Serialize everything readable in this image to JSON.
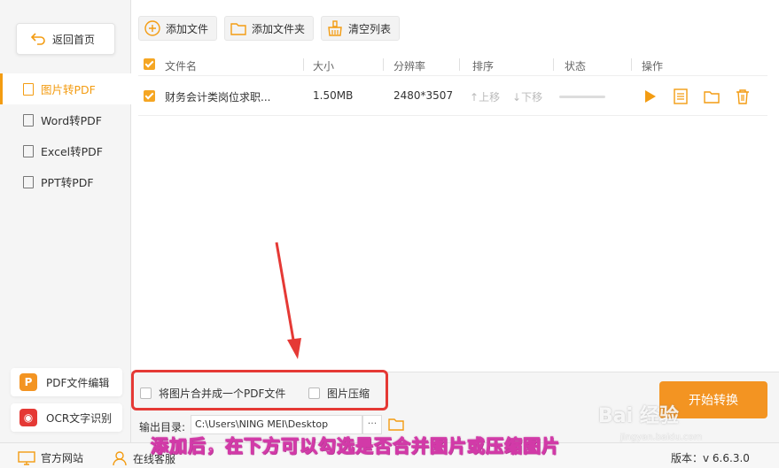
{
  "sidebar": {
    "back_label": "返回首页",
    "items": [
      {
        "label": "图片转PDF",
        "active": true
      },
      {
        "label": "Word转PDF",
        "active": false
      },
      {
        "label": "Excel转PDF",
        "active": false
      },
      {
        "label": "PPT转PDF",
        "active": false
      }
    ],
    "tools": [
      {
        "label": "PDF文件编辑"
      },
      {
        "label": "OCR文字识别"
      }
    ]
  },
  "toolbar": {
    "add_file": "添加文件",
    "add_folder": "添加文件夹",
    "clear_list": "清空列表"
  },
  "table": {
    "headers": {
      "filename": "文件名",
      "size": "大小",
      "resolution": "分辨率",
      "sort": "排序",
      "status": "状态",
      "action": "操作"
    },
    "rows": [
      {
        "filename": "财务会计类岗位求职...",
        "size": "1.50MB",
        "resolution": "2480*3507",
        "up": "上移",
        "down": "下移",
        "checked": true
      }
    ]
  },
  "options": {
    "merge_label": "将图片合并成一个PDF文件",
    "compress_label": "图片压缩"
  },
  "output": {
    "label": "输出目录:",
    "path": "C:\\Users\\NING MEI\\Desktop",
    "more": "···"
  },
  "start_button": "开始转换",
  "footer": {
    "website": "官方网站",
    "support": "在线客服",
    "version": "版本：v 6.6.3.0"
  },
  "caption": "添加后，在下方可以勾选是否合并图片或压缩图片",
  "watermark": {
    "brand": "Bai 经验",
    "url": "jingyan.baidu.com"
  },
  "colors": {
    "accent": "#f39c12",
    "highlight": "#e53935"
  }
}
